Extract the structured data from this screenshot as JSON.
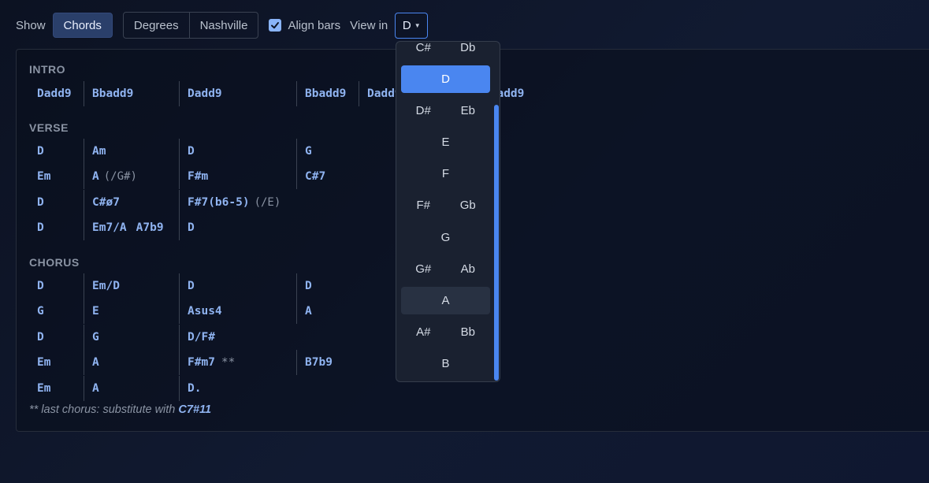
{
  "toolbar": {
    "show_label": "Show",
    "chords_label": "Chords",
    "degrees_label": "Degrees",
    "nashville_label": "Nashville",
    "align_bars_label": "Align bars",
    "align_bars_checked": true,
    "view_in_label": "View in",
    "key_value": "D"
  },
  "sections": {
    "intro": {
      "title": "INTRO",
      "rows": [
        [
          "Dadd9",
          "Bbadd9",
          "Dadd9",
          "Bbadd9",
          "Dadd9",
          "Bbadd9"
        ]
      ]
    },
    "verse": {
      "title": "VERSE",
      "rows": [
        {
          "c": [
            "D",
            "Am",
            "D",
            "G"
          ]
        },
        {
          "c": [
            "Em",
            "A",
            "F#m",
            "C#7"
          ],
          "slash1": "(/G#)"
        },
        {
          "c": [
            "D",
            "C#ø7",
            "F#7(b6-5)"
          ],
          "slash2": "(/E)"
        },
        {
          "c": [
            "D",
            "Em7/A",
            "A7b9",
            "D"
          ]
        }
      ]
    },
    "chorus": {
      "title": "CHORUS",
      "rows": [
        {
          "c": [
            "D",
            "Em/D",
            "D",
            "D"
          ]
        },
        {
          "c": [
            "G",
            "E",
            "Asus4",
            "A"
          ]
        },
        {
          "c": [
            "D",
            "G",
            "D/F#"
          ]
        },
        {
          "c": [
            "Em",
            "A",
            "F#m7",
            "B7b9"
          ],
          "mark": "**"
        },
        {
          "c": [
            "Em",
            "A",
            "D."
          ]
        }
      ]
    }
  },
  "footnote": {
    "text": "** last chorus: substitute with",
    "chord": "C7#11"
  },
  "key_dropdown": {
    "options": [
      [
        "C#",
        "Db"
      ],
      [
        "D"
      ],
      [
        "D#",
        "Eb"
      ],
      [
        "E"
      ],
      [
        "F"
      ],
      [
        "F#",
        "Gb"
      ],
      [
        "G"
      ],
      [
        "G#",
        "Ab"
      ],
      [
        "A"
      ],
      [
        "A#",
        "Bb"
      ],
      [
        "B"
      ]
    ],
    "selected": "D",
    "hovered": "A"
  },
  "colors": {
    "accent": "#4a86f0",
    "chord": "#8fb3f0",
    "background": "#0c1222"
  }
}
